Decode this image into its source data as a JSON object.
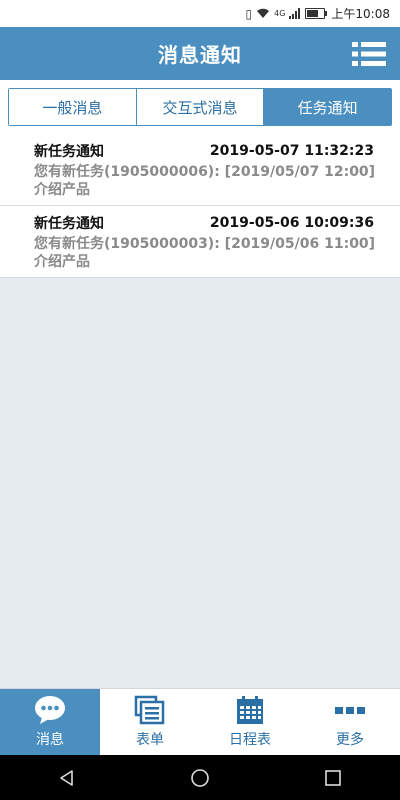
{
  "status_bar": {
    "time": "上午10:08",
    "signal_label": "4G"
  },
  "header": {
    "title": "消息通知",
    "menu_icon": "list-menu-icon"
  },
  "tabs": [
    {
      "label": "一般消息",
      "active": false
    },
    {
      "label": "交互式消息",
      "active": false
    },
    {
      "label": "任务通知",
      "active": true
    }
  ],
  "notifications": [
    {
      "title": "新任务通知",
      "time": "2019-05-07 11:32:23",
      "body_line1": "您有新任务(1905000006): [2019/05/07 12:00]",
      "body_line2": "介绍产品"
    },
    {
      "title": "新任务通知",
      "time": "2019-05-06 10:09:36",
      "body_line1": "您有新任务(1905000003): [2019/05/06 11:00]",
      "body_line2": "介绍产品"
    }
  ],
  "bottom_nav": [
    {
      "label": "消息",
      "icon": "chat-bubble-icon",
      "active": true
    },
    {
      "label": "表单",
      "icon": "forms-icon",
      "active": false
    },
    {
      "label": "日程表",
      "icon": "calendar-icon",
      "active": false
    },
    {
      "label": "更多",
      "icon": "more-dots-icon",
      "active": false
    }
  ],
  "colors": {
    "primary": "#4a8fc0",
    "background": "#e6ebef"
  }
}
